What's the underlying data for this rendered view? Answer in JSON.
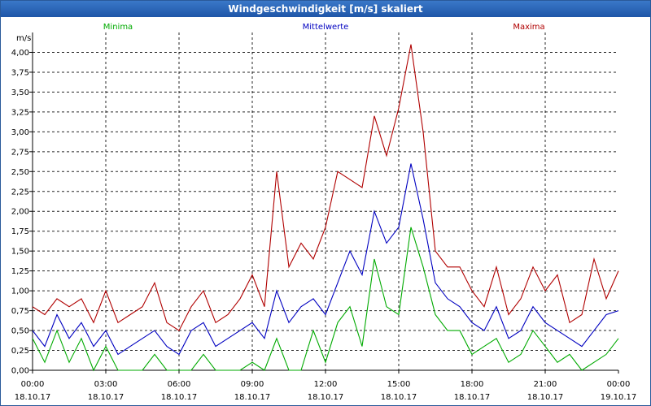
{
  "window": {
    "title": "Windgeschwindigkeit [m/s] skaliert"
  },
  "colors": {
    "minima": "#00aa00",
    "mittelwerte": "#0000c0",
    "maxima": "#b00000",
    "grid": "#000000"
  },
  "chart_data": {
    "type": "line",
    "title": "Windgeschwindigkeit [m/s] skaliert",
    "ylabel": "m/s",
    "ylim": [
      0,
      4.25
    ],
    "xlim": [
      0,
      24
    ],
    "yticks": [
      "0,00",
      "0,25",
      "0,50",
      "0,75",
      "1,00",
      "1,25",
      "1,50",
      "1,75",
      "2,00",
      "2,25",
      "2,50",
      "2,75",
      "3,00",
      "3,25",
      "3,50",
      "3,75",
      "4,00"
    ],
    "xticks": [
      {
        "time": "00:00",
        "date": "18.10.17"
      },
      {
        "time": "03:00",
        "date": "18.10.17"
      },
      {
        "time": "06:00",
        "date": "18.10.17"
      },
      {
        "time": "09:00",
        "date": "18.10.17"
      },
      {
        "time": "12:00",
        "date": "18.10.17"
      },
      {
        "time": "15:00",
        "date": "18.10.17"
      },
      {
        "time": "18:00",
        "date": "18.10.17"
      },
      {
        "time": "21:00",
        "date": "18.10.17"
      },
      {
        "time": "00:00",
        "date": "19.10.17"
      }
    ],
    "grid": true,
    "legend_position": "top",
    "series": [
      {
        "name": "Minima",
        "color": "#00aa00",
        "points": [
          [
            0,
            0.4
          ],
          [
            0.5,
            0.1
          ],
          [
            1,
            0.5
          ],
          [
            1.5,
            0.1
          ],
          [
            2,
            0.4
          ],
          [
            2.5,
            0.0
          ],
          [
            3,
            0.3
          ],
          [
            3.5,
            0.0
          ],
          [
            4,
            0.0
          ],
          [
            4.5,
            0.0
          ],
          [
            5,
            0.2
          ],
          [
            5.5,
            0.0
          ],
          [
            6,
            0.0
          ],
          [
            6.5,
            0.0
          ],
          [
            7,
            0.2
          ],
          [
            7.5,
            0.0
          ],
          [
            8,
            0.0
          ],
          [
            8.5,
            0.0
          ],
          [
            9,
            0.1
          ],
          [
            9.5,
            0.0
          ],
          [
            10,
            0.4
          ],
          [
            10.5,
            0.0
          ],
          [
            11,
            0.0
          ],
          [
            11.5,
            0.5
          ],
          [
            12,
            0.1
          ],
          [
            12.5,
            0.6
          ],
          [
            13,
            0.8
          ],
          [
            13.5,
            0.3
          ],
          [
            14,
            1.4
          ],
          [
            14.5,
            0.8
          ],
          [
            15,
            0.7
          ],
          [
            15.5,
            1.8
          ],
          [
            16,
            1.3
          ],
          [
            16.5,
            0.7
          ],
          [
            17,
            0.5
          ],
          [
            17.5,
            0.5
          ],
          [
            18,
            0.2
          ],
          [
            18.5,
            0.3
          ],
          [
            19,
            0.4
          ],
          [
            19.5,
            0.1
          ],
          [
            20,
            0.2
          ],
          [
            20.5,
            0.5
          ],
          [
            21,
            0.3
          ],
          [
            21.5,
            0.1
          ],
          [
            22,
            0.2
          ],
          [
            22.5,
            0.0
          ],
          [
            23,
            0.1
          ],
          [
            23.5,
            0.2
          ],
          [
            24,
            0.4
          ]
        ]
      },
      {
        "name": "Mittelwerte",
        "color": "#0000c0",
        "points": [
          [
            0,
            0.5
          ],
          [
            0.5,
            0.3
          ],
          [
            1,
            0.7
          ],
          [
            1.5,
            0.4
          ],
          [
            2,
            0.6
          ],
          [
            2.5,
            0.3
          ],
          [
            3,
            0.5
          ],
          [
            3.5,
            0.2
          ],
          [
            4,
            0.3
          ],
          [
            4.5,
            0.4
          ],
          [
            5,
            0.5
          ],
          [
            5.5,
            0.3
          ],
          [
            6,
            0.2
          ],
          [
            6.5,
            0.5
          ],
          [
            7,
            0.6
          ],
          [
            7.5,
            0.3
          ],
          [
            8,
            0.4
          ],
          [
            8.5,
            0.5
          ],
          [
            9,
            0.6
          ],
          [
            9.5,
            0.4
          ],
          [
            10,
            1.0
          ],
          [
            10.5,
            0.6
          ],
          [
            11,
            0.8
          ],
          [
            11.5,
            0.9
          ],
          [
            12,
            0.7
          ],
          [
            12.5,
            1.1
          ],
          [
            13,
            1.5
          ],
          [
            13.5,
            1.2
          ],
          [
            14,
            2.0
          ],
          [
            14.5,
            1.6
          ],
          [
            15,
            1.8
          ],
          [
            15.5,
            2.6
          ],
          [
            16,
            1.9
          ],
          [
            16.5,
            1.1
          ],
          [
            17,
            0.9
          ],
          [
            17.5,
            0.8
          ],
          [
            18,
            0.6
          ],
          [
            18.5,
            0.5
          ],
          [
            19,
            0.8
          ],
          [
            19.5,
            0.4
          ],
          [
            20,
            0.5
          ],
          [
            20.5,
            0.8
          ],
          [
            21,
            0.6
          ],
          [
            21.5,
            0.5
          ],
          [
            22,
            0.4
          ],
          [
            22.5,
            0.3
          ],
          [
            23,
            0.5
          ],
          [
            23.5,
            0.7
          ],
          [
            24,
            0.75
          ]
        ]
      },
      {
        "name": "Maxima",
        "color": "#b00000",
        "points": [
          [
            0,
            0.8
          ],
          [
            0.5,
            0.7
          ],
          [
            1,
            0.9
          ],
          [
            1.5,
            0.8
          ],
          [
            2,
            0.9
          ],
          [
            2.5,
            0.6
          ],
          [
            3,
            1.0
          ],
          [
            3.5,
            0.6
          ],
          [
            4,
            0.7
          ],
          [
            4.5,
            0.8
          ],
          [
            5,
            1.1
          ],
          [
            5.5,
            0.6
          ],
          [
            6,
            0.5
          ],
          [
            6.5,
            0.8
          ],
          [
            7,
            1.0
          ],
          [
            7.5,
            0.6
          ],
          [
            8,
            0.7
          ],
          [
            8.5,
            0.9
          ],
          [
            9,
            1.2
          ],
          [
            9.5,
            0.8
          ],
          [
            10,
            2.5
          ],
          [
            10.5,
            1.3
          ],
          [
            11,
            1.6
          ],
          [
            11.5,
            1.4
          ],
          [
            12,
            1.8
          ],
          [
            12.5,
            2.5
          ],
          [
            13,
            2.4
          ],
          [
            13.5,
            2.3
          ],
          [
            14,
            3.2
          ],
          [
            14.5,
            2.7
          ],
          [
            15,
            3.3
          ],
          [
            15.5,
            4.1
          ],
          [
            16,
            3.0
          ],
          [
            16.5,
            1.5
          ],
          [
            17,
            1.3
          ],
          [
            17.5,
            1.3
          ],
          [
            18,
            1.0
          ],
          [
            18.5,
            0.8
          ],
          [
            19,
            1.3
          ],
          [
            19.5,
            0.7
          ],
          [
            20,
            0.9
          ],
          [
            20.5,
            1.3
          ],
          [
            21,
            1.0
          ],
          [
            21.5,
            1.2
          ],
          [
            22,
            0.6
          ],
          [
            22.5,
            0.7
          ],
          [
            23,
            1.4
          ],
          [
            23.5,
            0.9
          ],
          [
            24,
            1.25
          ]
        ]
      }
    ]
  }
}
